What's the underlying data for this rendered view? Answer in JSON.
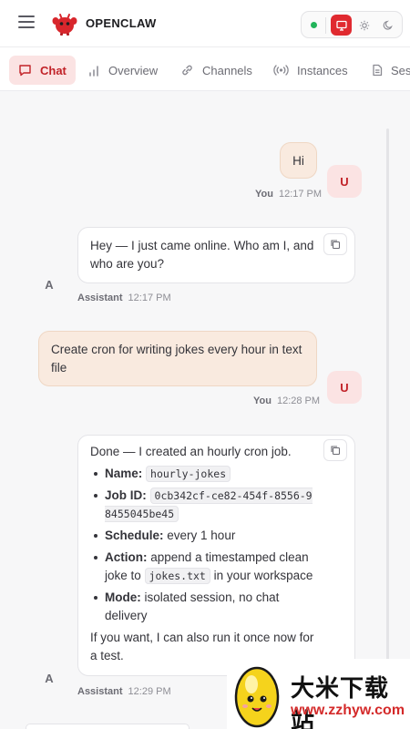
{
  "header": {
    "brand": "OPENCLAW",
    "theme_icons": [
      "monitor-icon",
      "sun-icon",
      "moon-icon"
    ]
  },
  "tabs": [
    {
      "label": "Chat",
      "icon": "chat-bubble-icon",
      "active": true
    },
    {
      "label": "Overview",
      "icon": "bar-chart-icon",
      "active": false
    },
    {
      "label": "Channels",
      "icon": "link-icon",
      "active": false
    },
    {
      "label": "Instances",
      "icon": "broadcast-icon",
      "active": false
    },
    {
      "label": "Ses",
      "icon": "document-icon",
      "active": false
    }
  ],
  "messages": [
    {
      "role": "user",
      "text": "Hi",
      "author": "You",
      "time": "12:17 PM",
      "avatar": "U"
    },
    {
      "role": "assistant",
      "text": "Hey — I just came online. Who am I, and who are you?",
      "author": "Assistant",
      "time": "12:17 PM",
      "avatar": "A"
    },
    {
      "role": "user",
      "text": "Create cron for writing jokes every hour in text file",
      "author": "You",
      "time": "12:28 PM",
      "avatar": "U"
    },
    {
      "role": "assistant",
      "intro": "Done — I created an hourly cron job.",
      "items": [
        {
          "label": "Name:",
          "code": "hourly-jokes"
        },
        {
          "label": "Job ID:",
          "code": "0cb342cf-ce82-454f-8556-98455045be45"
        },
        {
          "label": "Schedule:",
          "text": "every 1 hour"
        },
        {
          "label": "Action:",
          "text_before": "append a timestamped clean joke to",
          "code": "jokes.txt",
          "text_after": "in your workspace"
        },
        {
          "label": "Mode:",
          "text": "isolated session, no chat delivery"
        }
      ],
      "outro": "If you want, I can also run it once now for a test.",
      "author": "Assistant",
      "time": "12:29 PM",
      "avatar": "A"
    }
  ],
  "watermark": {
    "text": "大米下载站",
    "url": "www.zzhyw.com"
  },
  "colors": {
    "accent": "#e02a30",
    "accent_soft": "#fbe3e3",
    "user_bubble": "#f9eadf",
    "status_online": "#22b45a"
  }
}
